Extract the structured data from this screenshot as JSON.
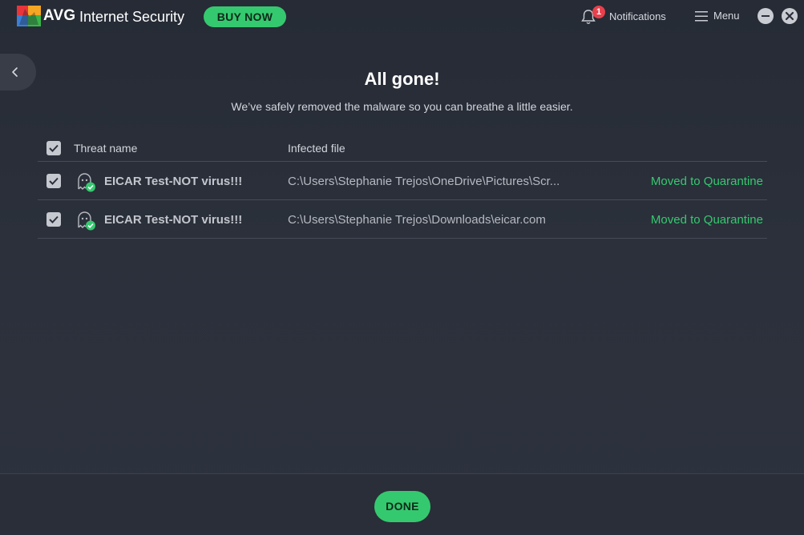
{
  "app": {
    "brand": "AVG",
    "product": "Internet Security",
    "buy_now_label": "BUY NOW",
    "logo_icon": "avg-logo-icon"
  },
  "header": {
    "notifications_label": "Notifications",
    "notifications_count": "1",
    "menu_label": "Menu"
  },
  "main": {
    "title": "All gone!",
    "subtitle": "We’ve safely removed the malware so you can breathe a little easier.",
    "columns": {
      "threat_name": "Threat name",
      "infected_file": "Infected file"
    },
    "threats": [
      {
        "name": "EICAR Test-NOT virus!!!",
        "file": "C:\\Users\\Stephanie Trejos\\OneDrive\\Pictures\\Scr...",
        "status": "Moved to Quarantine",
        "checked": true
      },
      {
        "name": "EICAR Test-NOT virus!!!",
        "file": "C:\\Users\\Stephanie Trejos\\Downloads\\eicar.com",
        "status": "Moved to Quarantine",
        "checked": true
      }
    ]
  },
  "footer": {
    "done_label": "DONE"
  },
  "colors": {
    "accent": "#35c96f",
    "badge": "#e8404c",
    "background": "#2b303b"
  }
}
